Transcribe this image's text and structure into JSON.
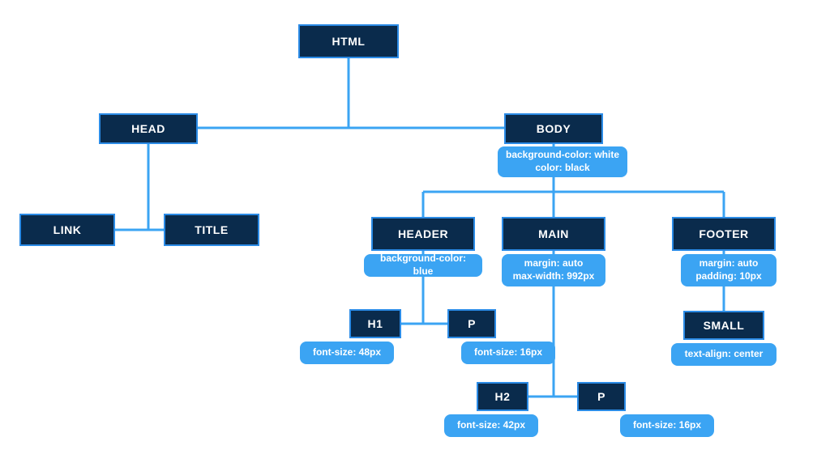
{
  "nodes": {
    "html": "HTML",
    "head": "HEAD",
    "body": "BODY",
    "link": "LINK",
    "title": "TITLE",
    "header": "HEADER",
    "main": "MAIN",
    "footer": "FOOTER",
    "h1": "H1",
    "p1": "P",
    "h2": "H2",
    "p2": "P",
    "small": "SMALL"
  },
  "css": {
    "body1": "background-color: white",
    "body2": "color: black",
    "header": "background-color: blue",
    "main1": "margin: auto",
    "main2": "max-width: 992px",
    "footer1": "margin: auto",
    "footer2": "padding: 10px",
    "h1": "font-size: 48px",
    "p1": "font-size: 16px",
    "h2": "font-size: 42px",
    "p2": "font-size: 16px",
    "small": "text-align: center"
  }
}
